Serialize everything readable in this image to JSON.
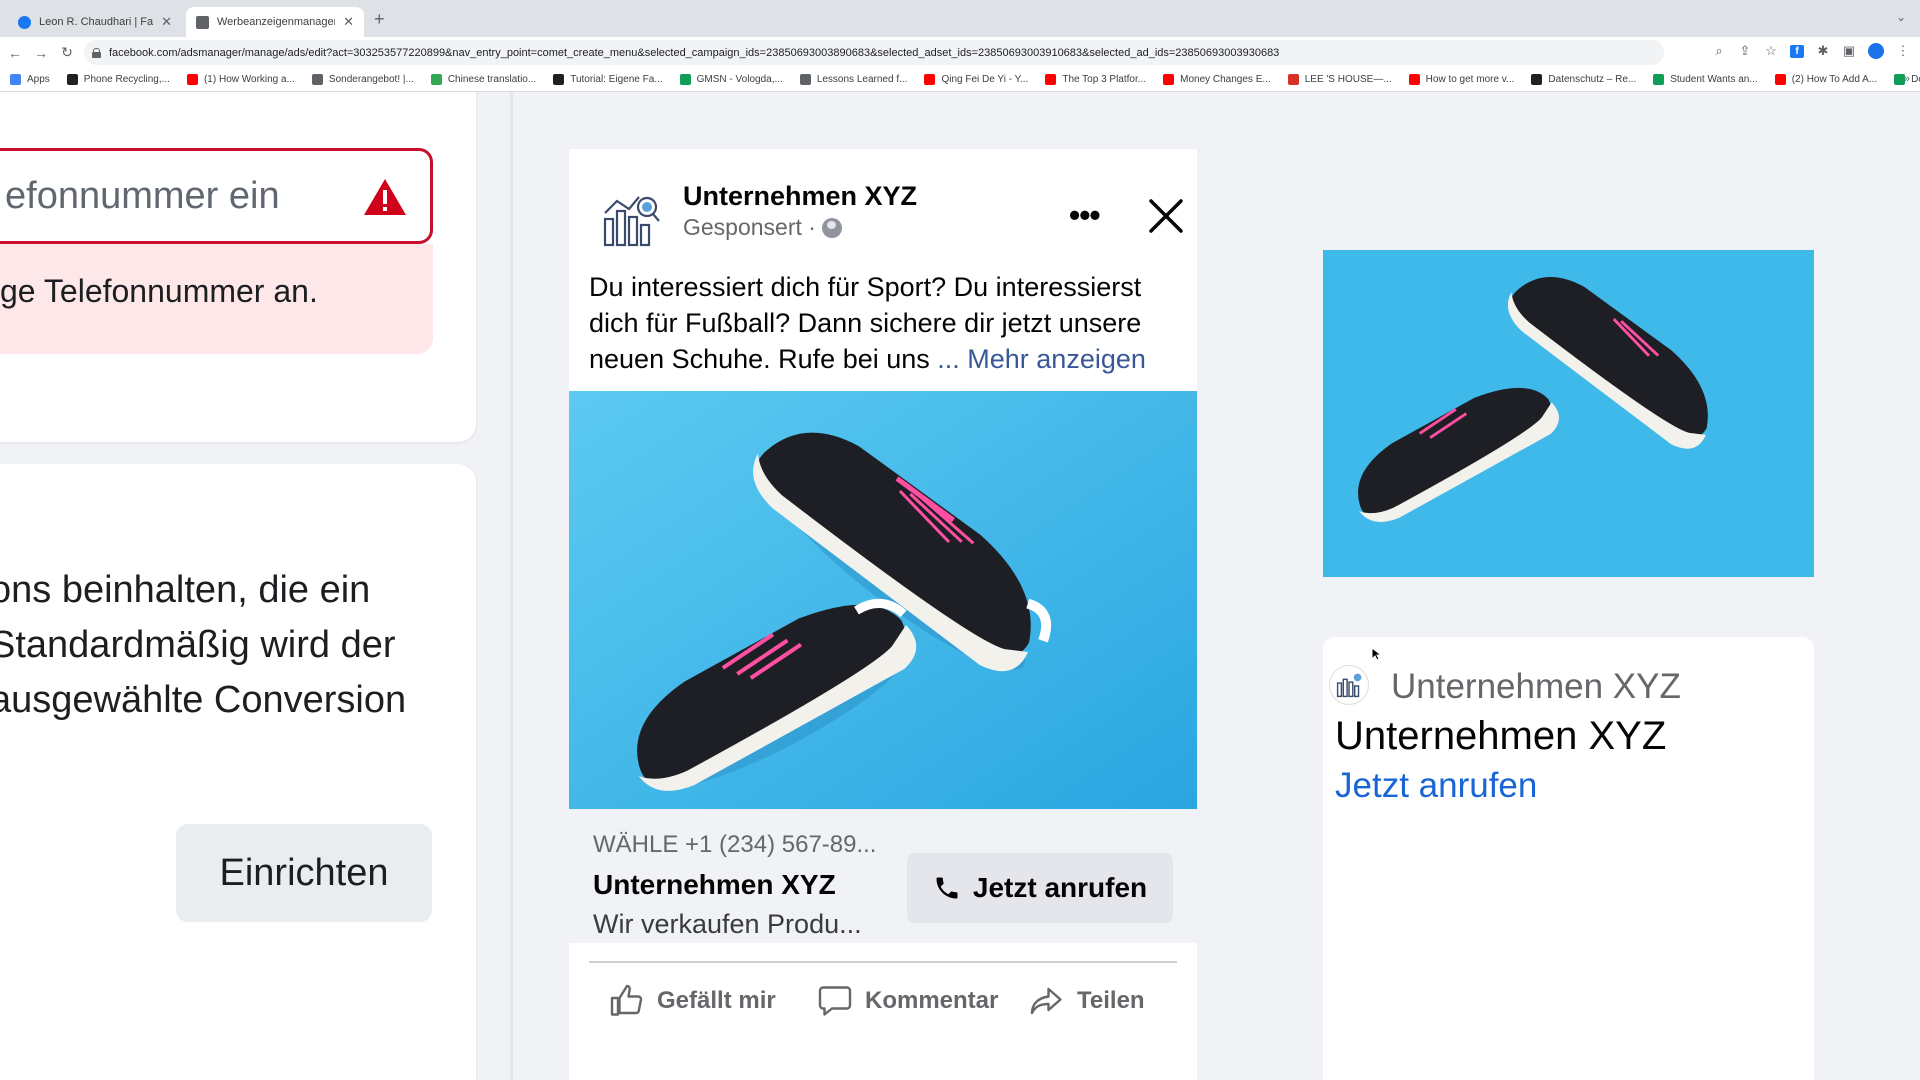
{
  "browser": {
    "tabs": [
      {
        "title": "Leon R. Chaudhari | Facebook",
        "color": "#1877f2"
      },
      {
        "title": "Werbeanzeigenmanager - Wer",
        "color": "#5f6368"
      }
    ],
    "url": "facebook.com/adsmanager/manage/ads/edit?act=303253577220899&nav_entry_point=comet_create_menu&selected_campaign_ids=23850693003890683&selected_adset_ids=23850693003910683&selected_ad_ids=23850693003930683",
    "bookmarks": [
      {
        "label": "Apps",
        "color": "#4285f4"
      },
      {
        "label": "Phone Recycling,...",
        "color": "#202124"
      },
      {
        "label": "(1) How Working a...",
        "color": "#ff0000"
      },
      {
        "label": "Sonderangebot! |...",
        "color": "#5f6368"
      },
      {
        "label": "Chinese translatio...",
        "color": "#34a853"
      },
      {
        "label": "Tutorial: Eigene Fa...",
        "color": "#202124"
      },
      {
        "label": "GMSN - Vologda,...",
        "color": "#0f9d58"
      },
      {
        "label": "Lessons Learned f...",
        "color": "#5f6368"
      },
      {
        "label": "Qing Fei De Yi - Y...",
        "color": "#ff0000"
      },
      {
        "label": "The Top 3 Platfor...",
        "color": "#ff0000"
      },
      {
        "label": "Money Changes E...",
        "color": "#ff0000"
      },
      {
        "label": "LEE 'S HOUSE—...",
        "color": "#d93025"
      },
      {
        "label": "How to get more v...",
        "color": "#ff0000"
      },
      {
        "label": "Datenschutz – Re...",
        "color": "#202124"
      },
      {
        "label": "Student Wants an...",
        "color": "#0f9d58"
      },
      {
        "label": "(2) How To Add A...",
        "color": "#ff0000"
      },
      {
        "label": "Download - Cooki...",
        "color": "#0f9d58"
      }
    ]
  },
  "left_panel": {
    "phone_input_text": "efonnummer ein",
    "error_text": "ge Telefonnummer an.",
    "conversion_lines": [
      "ons beinhalten, die ein",
      " Standardmäßig wird der",
      " ausgewählte Conversion"
    ],
    "setup_button": "Einrichten"
  },
  "ad_preview": {
    "page_name": "Unternehmen XYZ",
    "sponsored": "Gesponsert ·",
    "more_icon": "•••",
    "primary_text": "Du interessiert dich für Sport? Du interessierst dich für Fußball? Dann sichere dir jetzt unsere neuen Schuhe. Rufe bei uns ",
    "see_more": "... Mehr anzeigen",
    "footer": {
      "phone": "WÄHLE +1 (234) 567-89...",
      "headline": "Unternehmen XYZ",
      "description": "Wir verkaufen Produ..."
    },
    "cta_label": "Jetzt anrufen",
    "actions": {
      "like": "Gefällt mir",
      "comment": "Kommentar",
      "share": "Teilen"
    }
  },
  "right_preview": {
    "page_name": "Unternehmen XYZ",
    "headline": "Unternehmen XYZ",
    "cta": "Jetzt anrufen"
  },
  "colors": {
    "error_border": "#c8102e",
    "error_bg": "#fde7e9",
    "link": "#385898",
    "cta_blue": "#1a65d6",
    "image_bg": "#3fb9ea"
  }
}
